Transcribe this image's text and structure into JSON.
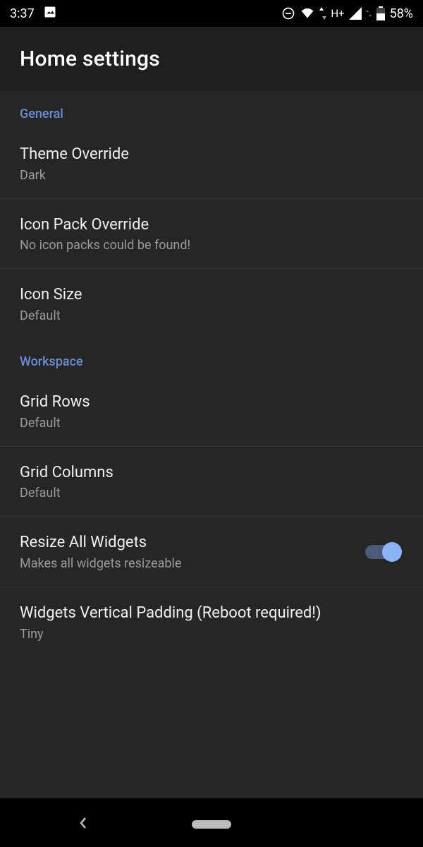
{
  "status": {
    "time": "3:37",
    "battery": "58%",
    "network": "H+"
  },
  "header": {
    "title": "Home settings"
  },
  "sections": {
    "general": {
      "label": "General",
      "theme": {
        "title": "Theme Override",
        "value": "Dark"
      },
      "iconPack": {
        "title": "Icon Pack Override",
        "value": "No icon packs could be found!"
      },
      "iconSize": {
        "title": "Icon Size",
        "value": "Default"
      }
    },
    "workspace": {
      "label": "Workspace",
      "gridRows": {
        "title": "Grid Rows",
        "value": "Default"
      },
      "gridColumns": {
        "title": "Grid Columns",
        "value": "Default"
      },
      "resizeWidgets": {
        "title": "Resize All Widgets",
        "subtitle": "Makes all widgets resizeable",
        "enabled": true
      },
      "verticalPadding": {
        "title": "Widgets Vertical Padding (Reboot required!)",
        "value": "Tiny"
      }
    }
  }
}
